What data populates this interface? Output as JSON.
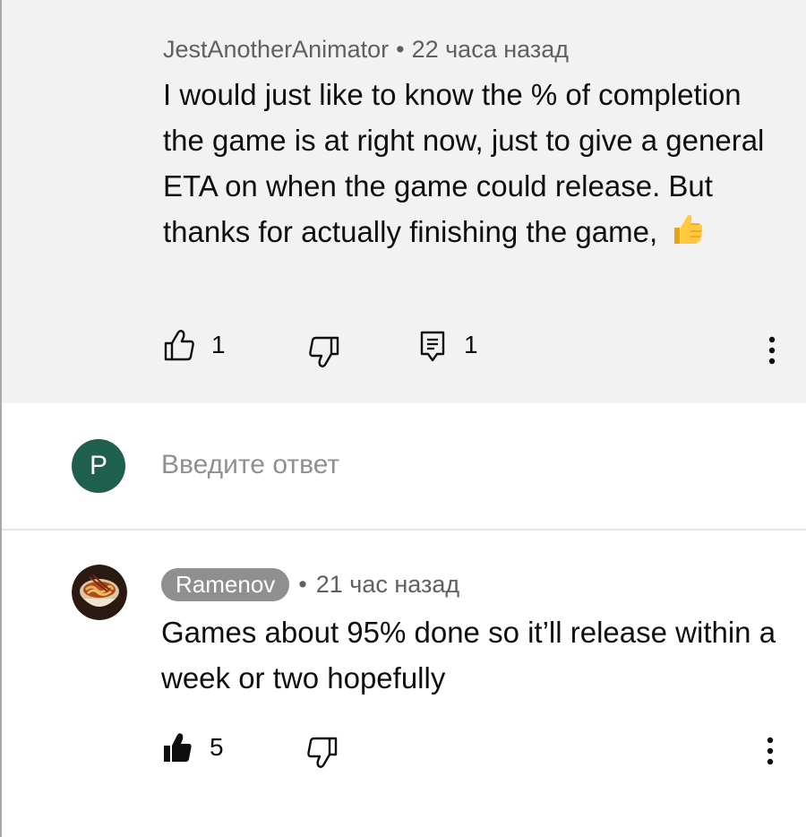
{
  "comment": {
    "author": "JestAnotherAnimator",
    "separator": "•",
    "time": "22 часа назад",
    "text": "I would just like to know the % of completion the game is at right now, just to give a general ETA on when the game could release. But thanks for actually finishing the game,",
    "emoji": "thumbs-up-emoji",
    "like_count": "1",
    "reply_count": "1"
  },
  "reply_box": {
    "avatar_letter": "P",
    "avatar_color": "#1f5f4e",
    "placeholder": "Введите ответ"
  },
  "reply": {
    "author": "Ramenov",
    "separator": "•",
    "time": "21 час назад",
    "text": "Games about 95% done so it’ll release within a week or two hopefully",
    "like_count": "5",
    "liked": true
  },
  "icons": {
    "like": "thumbs-up-outline-icon",
    "like_filled": "thumbs-up-filled-icon",
    "dislike": "thumbs-down-outline-icon",
    "reply": "reply-comment-icon",
    "more": "more-vertical-icon"
  }
}
